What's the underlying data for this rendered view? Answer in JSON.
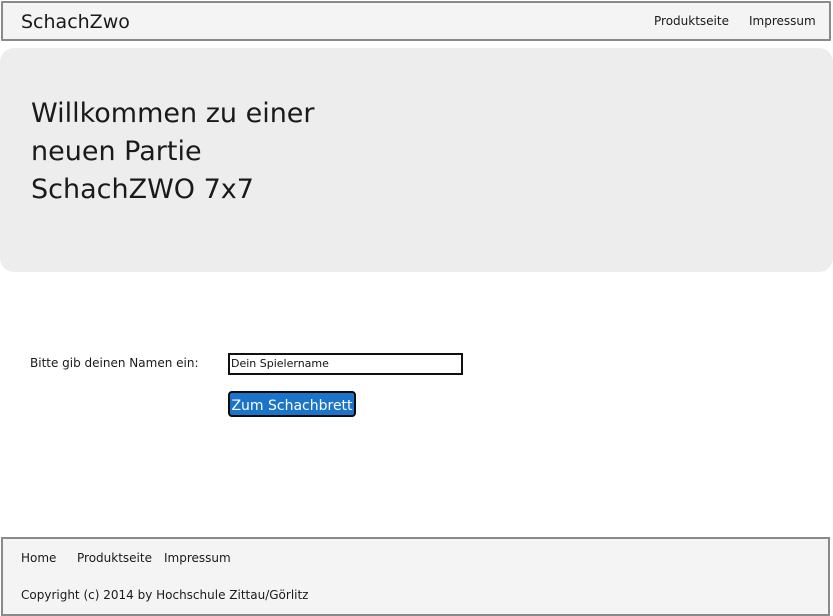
{
  "navbar": {
    "brand": "SchachZwo",
    "links": [
      "Produktseite",
      "Impressum"
    ]
  },
  "hero": {
    "title": "Willkommen zu einer\nneuen Partie\nSchachZWO 7x7"
  },
  "form": {
    "label": "Bitte gib deinen Namen ein:",
    "name_value": "Dein Spielername",
    "submit_label": "Zum Schachbrett"
  },
  "footer": {
    "links": [
      "Home",
      "Produktseite",
      "Impressum"
    ],
    "copyright": "Copyright (c) 2014 by Hochschule Zittau/Görlitz"
  },
  "colors": {
    "accent_button": "#1b74c9",
    "bar_background": "#f4f4f4",
    "hero_background": "#ededed"
  }
}
